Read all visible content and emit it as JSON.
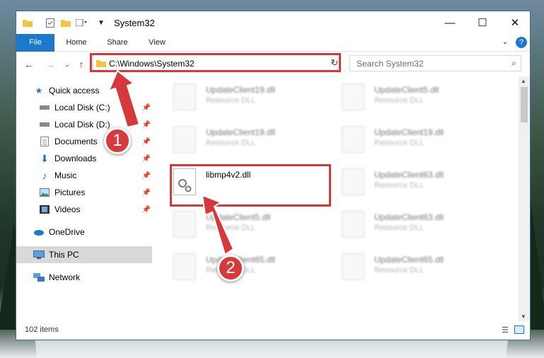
{
  "window": {
    "title": "System32"
  },
  "ribbon": {
    "tabs": [
      "File",
      "Home",
      "Share",
      "View"
    ]
  },
  "address": {
    "path": "C:\\Windows\\System32"
  },
  "search": {
    "placeholder": "Search System32"
  },
  "nav": {
    "quick_access": "Quick access",
    "items": [
      {
        "label": "Local Disk (C:)",
        "icon": "disk-icon"
      },
      {
        "label": "Local Disk (D:)",
        "icon": "disk-icon"
      },
      {
        "label": "Documents",
        "icon": "documents-icon"
      },
      {
        "label": "Downloads",
        "icon": "downloads-icon"
      },
      {
        "label": "Music",
        "icon": "music-icon"
      },
      {
        "label": "Pictures",
        "icon": "pictures-icon"
      },
      {
        "label": "Videos",
        "icon": "videos-icon"
      }
    ],
    "onedrive": "OneDrive",
    "this_pc": "This PC",
    "network": "Network"
  },
  "files": [
    {
      "name": "UpdateClient19.dll",
      "type": "Resource DLL",
      "state": "blurred"
    },
    {
      "name": "UpdateClient5.dll",
      "type": "Resource DLL",
      "state": "blurred"
    },
    {
      "name": "UpdateClient19.dll",
      "type": "Resource DLL",
      "state": "blurred"
    },
    {
      "name": "UpdateClient19.dll",
      "type": "Resource DLL",
      "state": "blurred"
    },
    {
      "name": "libmp4v2.dll",
      "type": "",
      "state": "focused"
    },
    {
      "name": "UpdateClient63.dll",
      "type": "Resource DLL",
      "state": "blurred"
    },
    {
      "name": "UpdateClient5.dll",
      "type": "Resource DLL",
      "state": "blurred"
    },
    {
      "name": "UpdateClient63.dll",
      "type": "Resource DLL",
      "state": "blurred"
    },
    {
      "name": "UpdateClient65.dll",
      "type": "Resource DLL",
      "state": "blurred"
    },
    {
      "name": "UpdateClient65.dll",
      "type": "Resource DLL",
      "state": "blurred"
    }
  ],
  "status": {
    "items": "102 items"
  },
  "annotations": {
    "step1": "1",
    "step2": "2",
    "color": "#d6393c"
  }
}
